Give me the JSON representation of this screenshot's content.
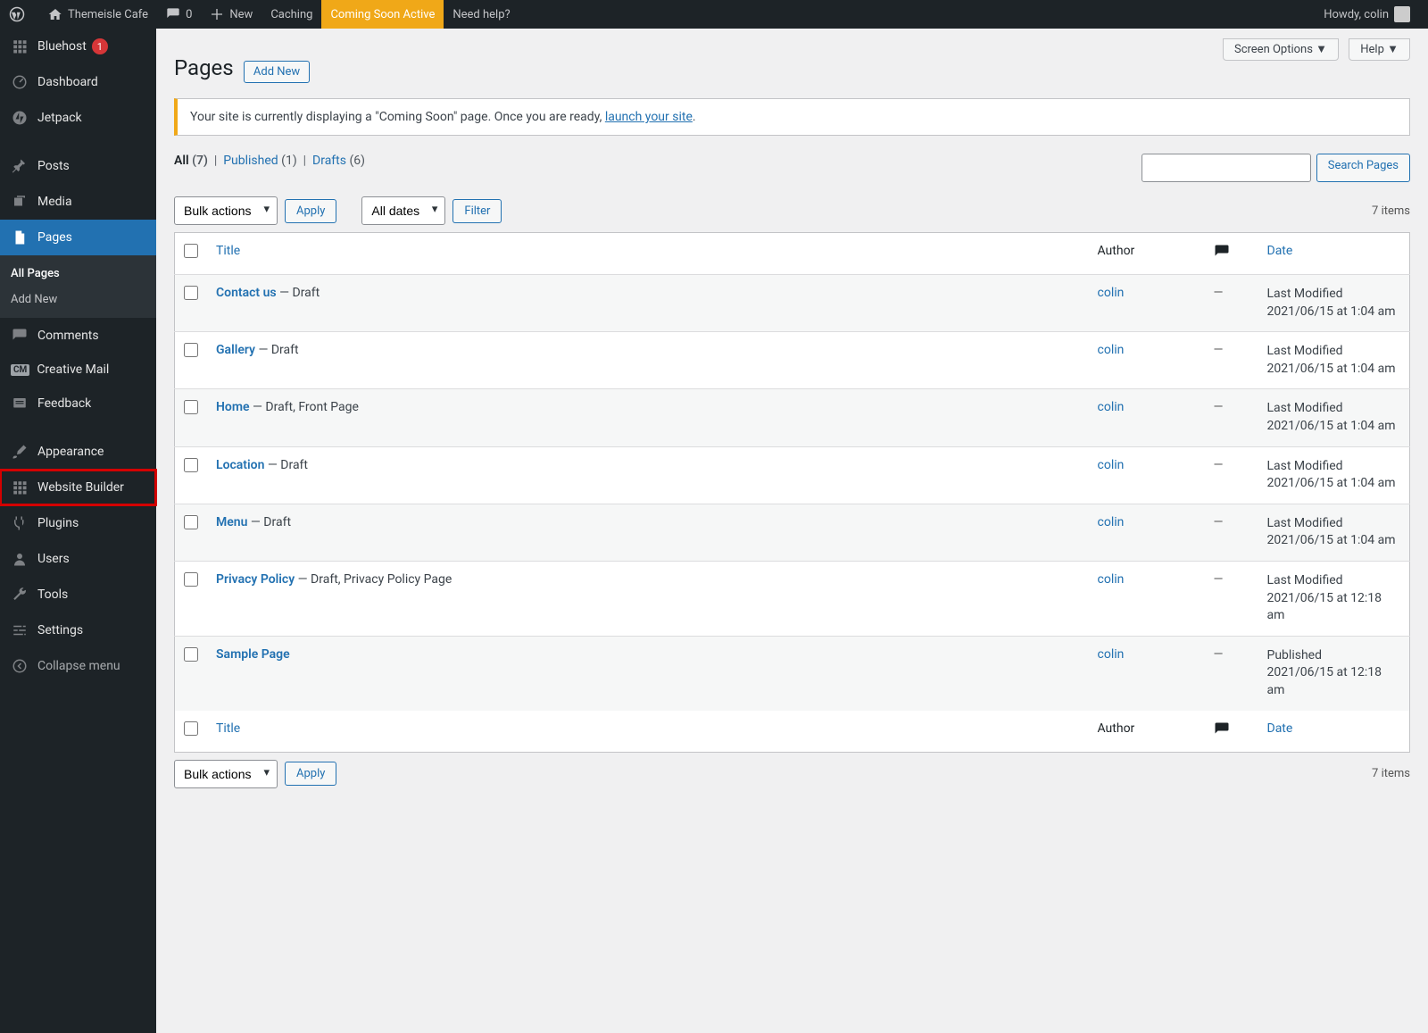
{
  "adminbar": {
    "site_name": "Themeisle Cafe",
    "comments": "0",
    "new": "New",
    "caching": "Caching",
    "coming_soon": "Coming Soon Active",
    "help": "Need help?",
    "howdy": "Howdy, colin"
  },
  "sidebar": {
    "bluehost": "Bluehost",
    "bluehost_badge": "1",
    "dashboard": "Dashboard",
    "jetpack": "Jetpack",
    "posts": "Posts",
    "media": "Media",
    "pages": "Pages",
    "sub_all_pages": "All Pages",
    "sub_add_new": "Add New",
    "comments": "Comments",
    "creative_mail": "Creative Mail",
    "feedback": "Feedback",
    "appearance": "Appearance",
    "website_builder": "Website Builder",
    "plugins": "Plugins",
    "users": "Users",
    "tools": "Tools",
    "settings": "Settings",
    "collapse": "Collapse menu"
  },
  "header": {
    "screen_options": "Screen Options ▼",
    "help": "Help ▼",
    "title": "Pages",
    "add_new": "Add New"
  },
  "notice": {
    "text_before": "Your site is currently displaying a \"Coming Soon\" page. Once you are ready, ",
    "link": "launch your site",
    "text_after": "."
  },
  "filters": {
    "all": "All",
    "all_count": "(7)",
    "published": "Published",
    "published_count": "(1)",
    "drafts": "Drafts",
    "drafts_count": "(6)",
    "bulk_actions": "Bulk actions",
    "apply": "Apply",
    "all_dates": "All dates",
    "filter": "Filter",
    "items": "7 items",
    "search": "Search Pages"
  },
  "columns": {
    "title": "Title",
    "author": "Author",
    "date": "Date"
  },
  "rows": [
    {
      "title": "Contact us",
      "suffix": " — Draft",
      "author": "colin",
      "comments": "—",
      "date_label": "Last Modified",
      "date": "2021/06/15 at 1:04 am"
    },
    {
      "title": "Gallery",
      "suffix": " — Draft",
      "author": "colin",
      "comments": "—",
      "date_label": "Last Modified",
      "date": "2021/06/15 at 1:04 am"
    },
    {
      "title": "Home",
      "suffix": " — Draft, Front Page",
      "author": "colin",
      "comments": "—",
      "date_label": "Last Modified",
      "date": "2021/06/15 at 1:04 am"
    },
    {
      "title": "Location",
      "suffix": " — Draft",
      "author": "colin",
      "comments": "—",
      "date_label": "Last Modified",
      "date": "2021/06/15 at 1:04 am"
    },
    {
      "title": "Menu",
      "suffix": " — Draft",
      "author": "colin",
      "comments": "—",
      "date_label": "Last Modified",
      "date": "2021/06/15 at 1:04 am"
    },
    {
      "title": "Privacy Policy",
      "suffix": " — Draft, Privacy Policy Page",
      "author": "colin",
      "comments": "—",
      "date_label": "Last Modified",
      "date": "2021/06/15 at 12:18 am"
    },
    {
      "title": "Sample Page",
      "suffix": "",
      "author": "colin",
      "comments": "—",
      "date_label": "Published",
      "date": "2021/06/15 at 12:18 am"
    }
  ]
}
